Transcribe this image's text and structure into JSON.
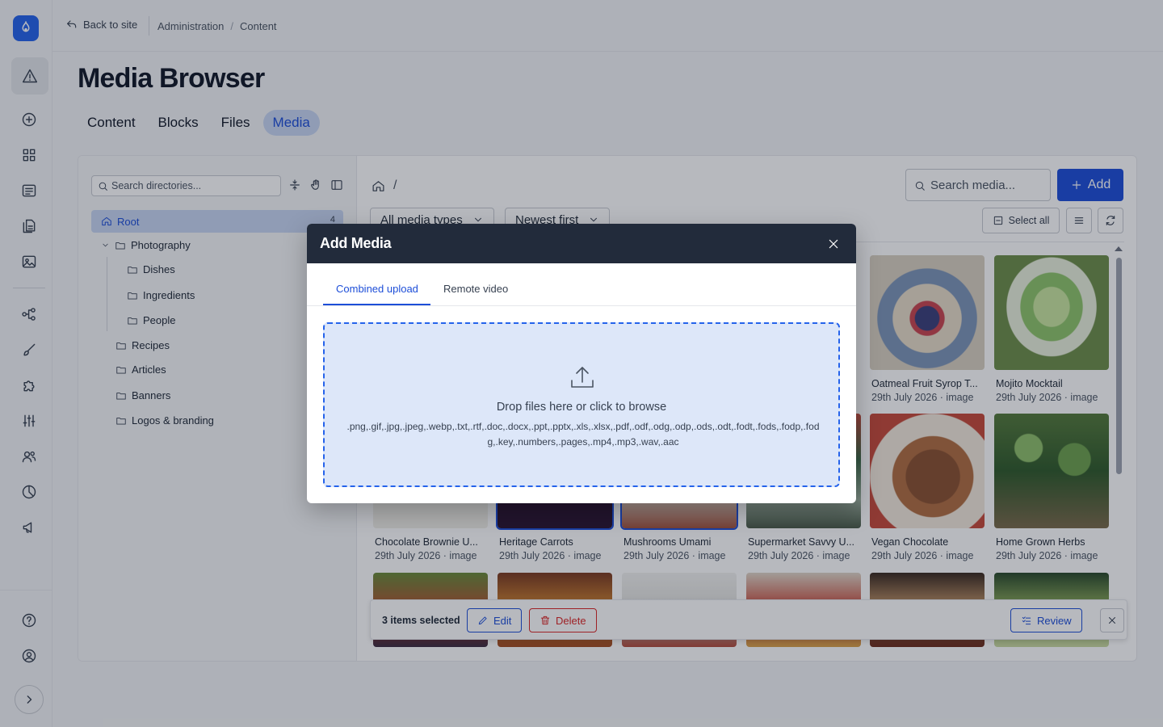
{
  "topbar": {
    "back_label": "Back to site",
    "breadcrumbs": [
      "Administration",
      "Content"
    ]
  },
  "page": {
    "title": "Media Browser",
    "tabs": [
      {
        "label": "Content",
        "active": false
      },
      {
        "label": "Blocks",
        "active": false
      },
      {
        "label": "Files",
        "active": false
      },
      {
        "label": "Media",
        "active": true
      }
    ]
  },
  "tree": {
    "search_placeholder": "Search directories...",
    "root": {
      "label": "Root",
      "count": "4"
    },
    "nodes": [
      "Photography",
      "Dishes",
      "Ingredients",
      "People",
      "Recipes",
      "Articles",
      "Banners",
      "Logos & branding"
    ]
  },
  "toolbar": {
    "path_sep": "/",
    "search_placeholder": "Search media...",
    "add_label": "Add",
    "filter_type": "All media types",
    "filter_sort": "Newest first",
    "select_all_label": "Select all"
  },
  "grid": {
    "items": [
      {
        "name": "Oatmeal Fruit Syrop T...",
        "meta": "29th July 2026 · image",
        "selected": false
      },
      {
        "name": "Mojito Mocktail",
        "meta": "29th July 2026 · image",
        "selected": false
      },
      {
        "name": "Chocolate Brownie U...",
        "meta": "29th July 2026 · image",
        "selected": false
      },
      {
        "name": "Heritage Carrots",
        "meta": "29th July 2026 · image",
        "selected": true
      },
      {
        "name": "Mushrooms Umami",
        "meta": "29th July 2026 · image",
        "selected": true
      },
      {
        "name": "Supermarket Savvy U...",
        "meta": "29th July 2026 · image",
        "selected": false
      },
      {
        "name": "Vegan Chocolate",
        "meta": "29th July 2026 · image",
        "selected": false
      },
      {
        "name": "Home Grown Herbs",
        "meta": "29th July 2026 · image",
        "selected": false
      }
    ]
  },
  "selection": {
    "count_label": "3 items selected",
    "edit_label": "Edit",
    "delete_label": "Delete",
    "review_label": "Review"
  },
  "modal": {
    "title": "Add Media",
    "tabs": [
      {
        "label": "Combined upload",
        "active": true
      },
      {
        "label": "Remote video",
        "active": false
      }
    ],
    "drop_label": "Drop files here or click to browse",
    "accepted_types": ".png,.gif,.jpg,.jpeg,.webp,.txt,.rtf,.doc,.docx,.ppt,.pptx,.xls,.xlsx,.pdf,.odf,.odg,.odp,.ods,.odt,.fodt,.fods,.fodp,.fodg,.key,.numbers,.pages,.mp4,.mp3,.wav,.aac"
  },
  "colors": {
    "accent": "#1d4ed8",
    "danger": "#dc2626",
    "modal_header": "#222b3b",
    "dropzone_bg": "#dde7f9"
  },
  "icons": [
    "drupal-logo-icon",
    "warning-icon",
    "plus-circle-icon",
    "grid-icon",
    "list-icon",
    "files-icon",
    "image-icon",
    "structure-icon",
    "brush-icon",
    "puzzle-icon",
    "sliders-icon",
    "users-icon",
    "chart-icon",
    "megaphone-icon",
    "help-icon",
    "user-circle-icon",
    "chevron-right-icon"
  ]
}
